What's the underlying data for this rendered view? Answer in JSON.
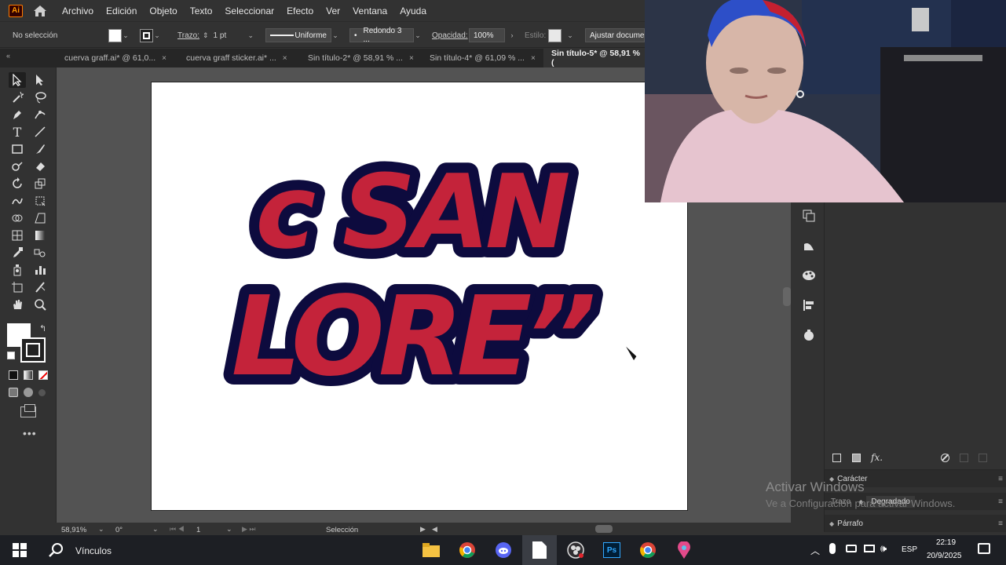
{
  "menubar": {
    "logo": "Ai",
    "items": [
      "Archivo",
      "Edición",
      "Objeto",
      "Texto",
      "Seleccionar",
      "Efecto",
      "Ver",
      "Ventana",
      "Ayuda"
    ]
  },
  "control": {
    "selection": "No selección",
    "stroke_label": "Trazo:",
    "stroke_value": "1 pt",
    "profile": "Uniforme",
    "brush": "Redondo 3 ...",
    "opacity_label": "Opacidad:",
    "opacity_value": "100%",
    "style_label": "Estilo:",
    "doc_button": "Ajustar documento"
  },
  "tabs": [
    {
      "label": "cuerva graff.ai* @ 61,0...",
      "close": "×"
    },
    {
      "label": "cuerva graff sticker.ai* ...",
      "close": "×"
    },
    {
      "label": "Sin título-2* @ 58,91 % ...",
      "close": "×"
    },
    {
      "label": "Sin título-4* @ 61,09 % ...",
      "close": "×"
    },
    {
      "label": "Sin título-5* @ 58,91 % (",
      "close": ""
    }
  ],
  "artwork": {
    "line1": "c SAN",
    "line2": "LORE”",
    "fill": "#c4233a",
    "outline": "#0d0b3e"
  },
  "statusbar": {
    "zoom": "58,91%",
    "rotation": "0°",
    "artboard": "1",
    "tool": "Selección"
  },
  "panels": {
    "caracter": "Carácter",
    "trazo": "Trazo",
    "degradado": "Degradado",
    "parrafo": "Párrafo"
  },
  "watermark": {
    "line1": "Activar Windows",
    "line2": "Ve a Configuración para activar Windows."
  },
  "taskbar": {
    "search": "Vínculos",
    "lang": "ESP",
    "time": "22:19",
    "date": "20/9/2025"
  },
  "colors": {
    "accent_orange": "#ff9a00",
    "ui_dark": "#323232",
    "canvas": "#535353"
  }
}
